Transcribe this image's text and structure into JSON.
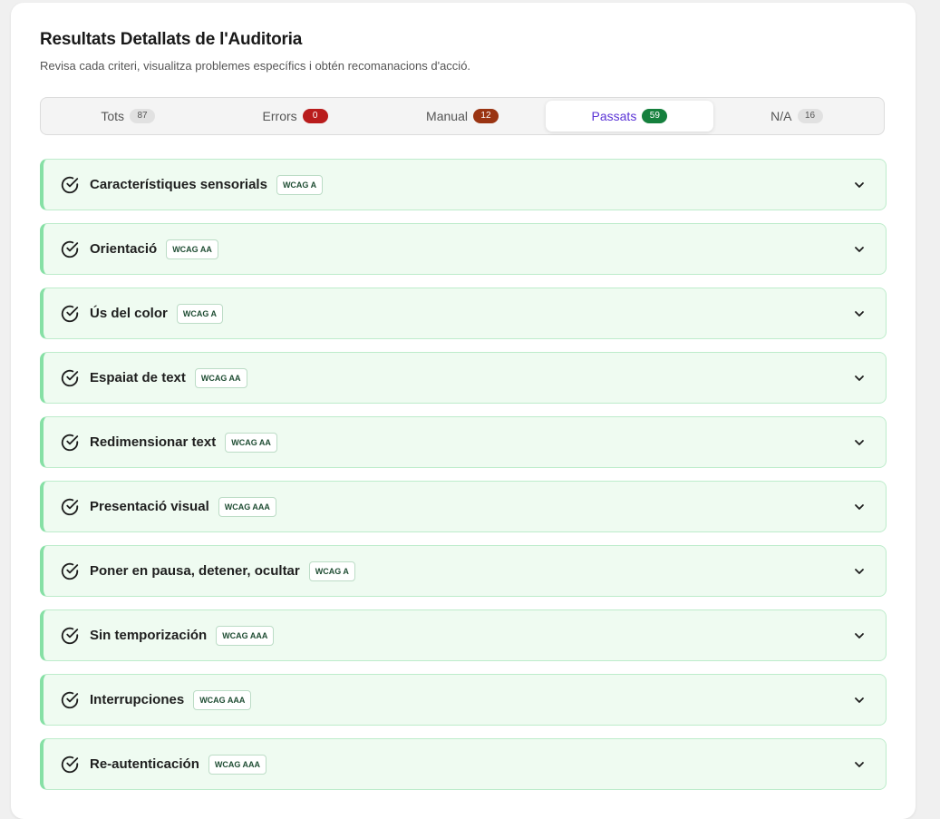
{
  "header": {
    "title": "Resultats Detallats de l'Auditoria",
    "subtitle": "Revisa cada criteri, visualitza problemes específics i obtén recomanacions d'acció."
  },
  "tabs": [
    {
      "label": "Tots",
      "count": "87",
      "active": false
    },
    {
      "label": "Errors",
      "count": "0",
      "active": false
    },
    {
      "label": "Manual",
      "count": "12",
      "active": false
    },
    {
      "label": "Passats",
      "count": "59",
      "active": true
    },
    {
      "label": "N/A",
      "count": "16",
      "active": false
    }
  ],
  "items": [
    {
      "label": "Característiques sensorials",
      "level": "WCAG A"
    },
    {
      "label": "Orientació",
      "level": "WCAG AA"
    },
    {
      "label": "Ús del color",
      "level": "WCAG A"
    },
    {
      "label": "Espaiat de text",
      "level": "WCAG AA"
    },
    {
      "label": "Redimensionar text",
      "level": "WCAG AA"
    },
    {
      "label": "Presentació visual",
      "level": "WCAG AAA"
    },
    {
      "label": "Poner en pausa, detener, ocultar",
      "level": "WCAG A"
    },
    {
      "label": "Sin temporización",
      "level": "WCAG AAA"
    },
    {
      "label": "Interrupciones",
      "level": "WCAG AAA"
    },
    {
      "label": "Re-autenticación",
      "level": "WCAG AAA"
    }
  ],
  "icons": {
    "item_status": "check-circle-icon",
    "expand": "chevron-down-icon"
  },
  "colors": {
    "accent": "#5b34d6",
    "passed": "#15803d",
    "errors": "#b91c1c",
    "manual": "#9a3412",
    "item_bg": "#effbf1",
    "item_border": "#86e0a5"
  }
}
